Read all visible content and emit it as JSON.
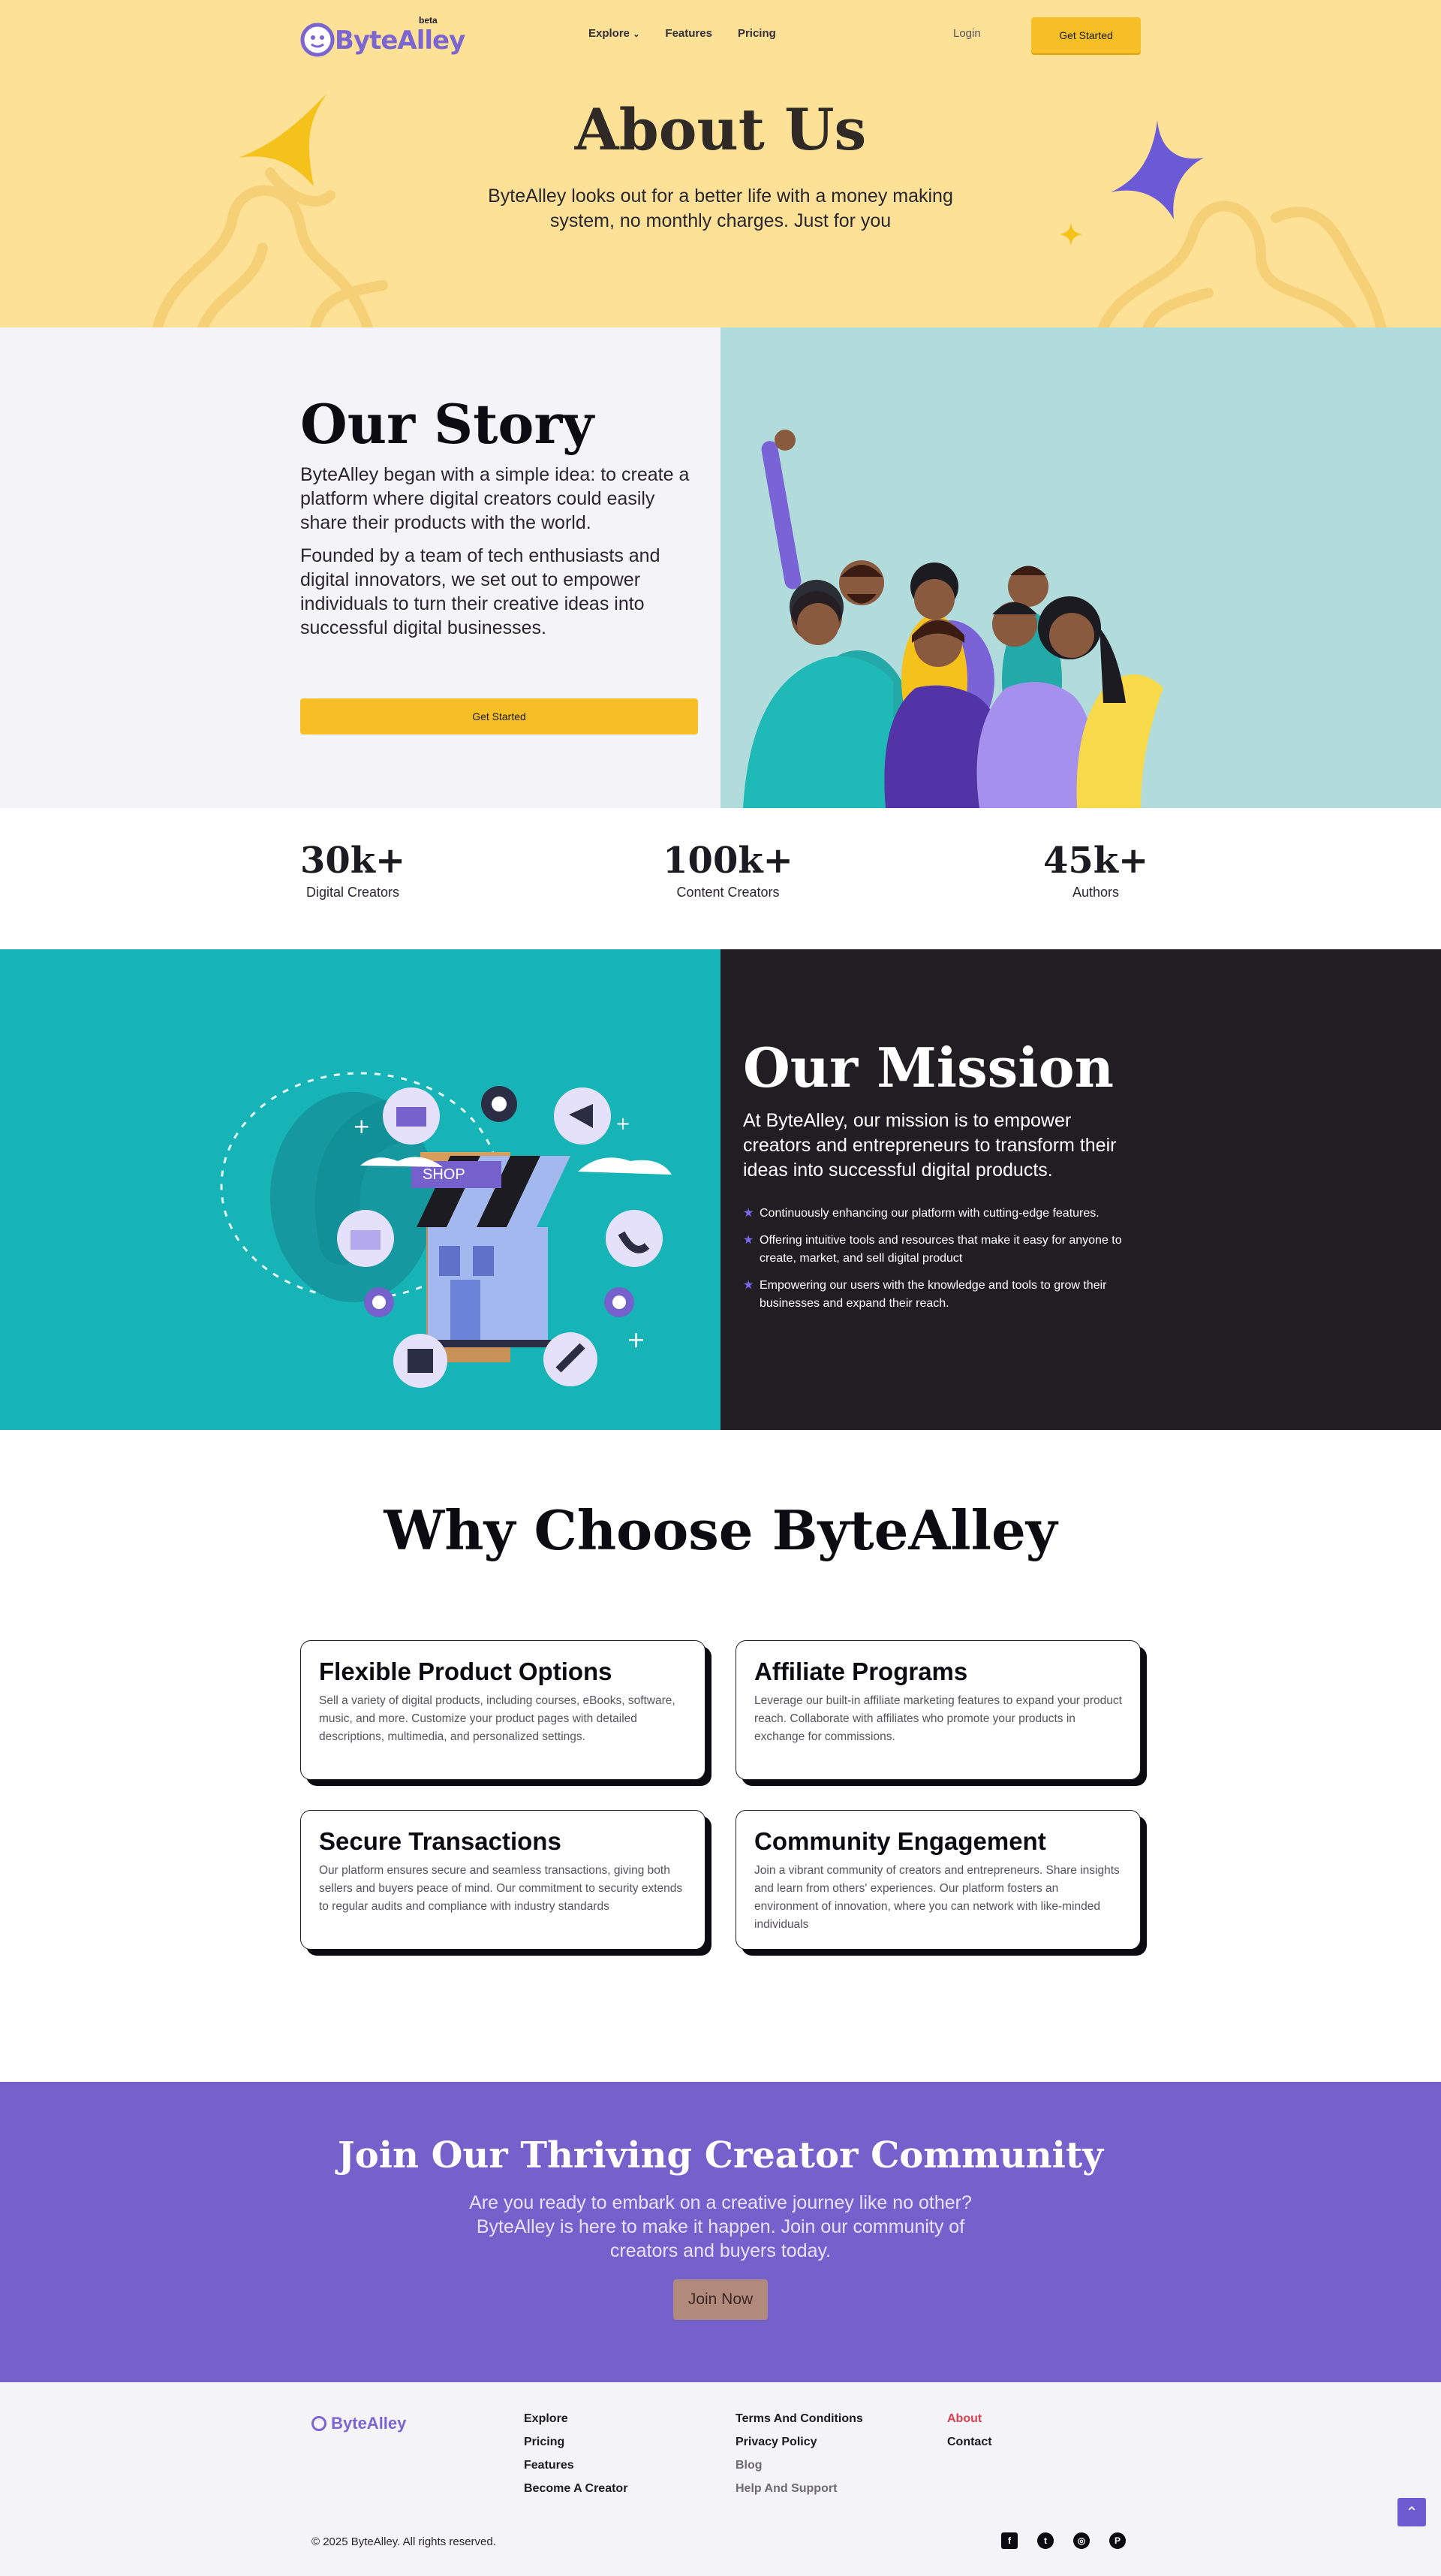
{
  "header": {
    "logo_text": "ByteAlley",
    "beta": "beta",
    "nav": [
      {
        "label": "Explore"
      },
      {
        "label": "Features"
      },
      {
        "label": "Pricing"
      }
    ],
    "login": "Login",
    "cta": "Get Started"
  },
  "hero": {
    "title": "About Us",
    "subtitle": "ByteAlley looks out for a better life with a money making system, no monthly charges. Just for you"
  },
  "story": {
    "title": "Our Story",
    "p1": "ByteAlley began with a simple idea: to create a platform where digital creators could easily share their products with the world.",
    "p2": "Founded by a team of tech enthusiasts and digital innovators, we set out to empower individuals to turn their creative ideas into successful digital businesses.",
    "cta": "Get Started"
  },
  "stats": [
    {
      "value": "30k+",
      "label": "Digital Creators"
    },
    {
      "value": "100k+",
      "label": "Content Creators"
    },
    {
      "value": "45k+",
      "label": "Authors"
    }
  ],
  "mission": {
    "title": "Our Mission",
    "intro": "At ByteAlley, our mission is to empower creators and entrepreneurs to transform their ideas into successful digital products.",
    "shop_label": "SHOP",
    "items": [
      "Continuously enhancing our platform with cutting-edge features.",
      "Offering intuitive tools and resources that make it easy for anyone to create, market, and sell digital product",
      "Empowering our users with the knowledge and tools to grow their businesses and expand their reach."
    ]
  },
  "why": {
    "title": "Why Choose ByteAlley",
    "cards": [
      {
        "title": "Flexible Product Options",
        "text": "Sell a variety of digital products, including courses, eBooks, software, music, and more. Customize your product pages with detailed descriptions, multimedia, and personalized settings."
      },
      {
        "title": "Affiliate Programs",
        "text": "Leverage our built-in affiliate marketing features to expand your product reach. Collaborate with affiliates who promote your products in exchange for commissions."
      },
      {
        "title": "Secure Transactions",
        "text": "Our platform ensures secure and seamless transactions, giving both sellers and buyers peace of mind. Our commitment to security extends to regular audits and compliance with industry standards"
      },
      {
        "title": "Community Engagement",
        "text": "Join a vibrant community of creators and entrepreneurs. Share insights and learn from others' experiences. Our platform fosters an environment of innovation, where you can network with like-minded individuals"
      }
    ]
  },
  "community": {
    "title": "Join Our Thriving Creator Community",
    "text": "Are you ready to embark on a creative journey like no other? ByteAlley is here to make it happen. Join our community of creators and buyers today.",
    "cta": "Join Now"
  },
  "footer": {
    "logo_text": "ByteAlley",
    "col1": [
      "Explore",
      "Pricing",
      "Features",
      "Become A Creator"
    ],
    "col2": [
      "Terms And Conditions",
      "Privacy Policy",
      "Blog",
      "Help And Support"
    ],
    "col3": [
      "About",
      "Contact"
    ],
    "copyright": "© 2025 ByteAlley. All rights reserved.",
    "socials": [
      {
        "icon": "facebook-icon",
        "glyph": "f"
      },
      {
        "icon": "twitter-icon",
        "glyph": "t"
      },
      {
        "icon": "dribbble-icon",
        "glyph": "◎"
      },
      {
        "icon": "pinterest-icon",
        "glyph": "P"
      }
    ]
  },
  "colors": {
    "hero_bg": "#fde197",
    "accent_yellow": "#f5bf25",
    "purple": "#7461cb",
    "teal": "#17b4b7",
    "dark": "#201e23"
  }
}
